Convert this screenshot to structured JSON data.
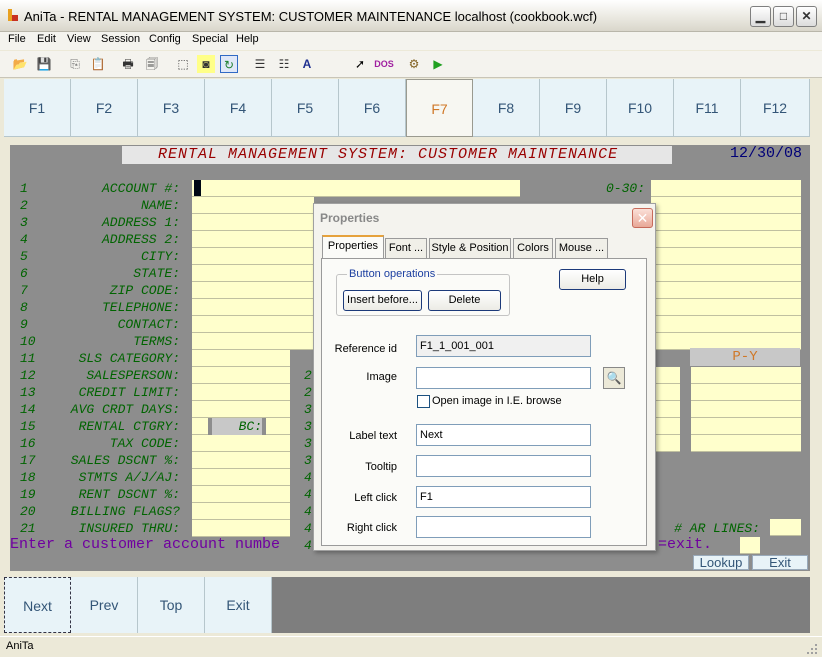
{
  "window": {
    "title": "AniTa - RENTAL MANAGEMENT SYSTEM: CUSTOMER MAINTENANCE  localhost (cookbook.wcf)",
    "minimize_glyph": "▁",
    "restore_glyph": "□",
    "close_glyph": "✕"
  },
  "menu": [
    "File",
    "Edit",
    "View",
    "Session",
    "Config",
    "Special",
    "Help"
  ],
  "toolbar_icons": [
    "open-folder-icon",
    "save-icon",
    "copy-icon",
    "paste-icon",
    "print-icon",
    "print-preview-icon",
    "select-icon",
    "toggle-icon",
    "refresh-icon",
    "list-icon",
    "list-detail-icon",
    "font-icon",
    "pointer-help-icon",
    "dos-icon",
    "settings-icon",
    "play-icon"
  ],
  "toolbar_glyphs": [
    "📂",
    "💾",
    "⎘",
    "📋",
    "🖶",
    "🗐",
    "⬚",
    "◙",
    "↻",
    "☰",
    "☷",
    "A",
    "➚",
    "DOS",
    "⚙",
    "▶"
  ],
  "fkeys": [
    "F1",
    "F2",
    "F3",
    "F4",
    "F5",
    "F6",
    "F7",
    "F8",
    "F9",
    "F10",
    "F11",
    "F12"
  ],
  "active_fkey": "F7",
  "screen": {
    "heading": "RENTAL MANAGEMENT SYSTEM: CUSTOMER MAINTENANCE",
    "date": "12/30/08",
    "rows": [
      {
        "num": "1",
        "label": "ACCOUNT #:"
      },
      {
        "num": "2",
        "label": "NAME:"
      },
      {
        "num": "3",
        "label": "ADDRESS 1:"
      },
      {
        "num": "4",
        "label": "ADDRESS 2:"
      },
      {
        "num": "5",
        "label": "CITY:"
      },
      {
        "num": "6",
        "label": "STATE:"
      },
      {
        "num": "7",
        "label": "ZIP CODE:"
      },
      {
        "num": "8",
        "label": "TELEPHONE:"
      },
      {
        "num": "9",
        "label": "CONTACT:"
      },
      {
        "num": "10",
        "label": "TERMS:"
      },
      {
        "num": "11",
        "label": "SLS CATEGORY:"
      },
      {
        "num": "12",
        "label": "SALESPERSON:"
      },
      {
        "num": "13",
        "label": "CREDIT LIMIT:"
      },
      {
        "num": "14",
        "label": "AVG CRDT DAYS:"
      },
      {
        "num": "15",
        "label": "RENTAL CTGRY:"
      },
      {
        "num": "16",
        "label": "TAX CODE:"
      },
      {
        "num": "17",
        "label": "SALES DSCNT %:"
      },
      {
        "num": "18",
        "label": "STMTS  A/J/AJ:"
      },
      {
        "num": "19",
        "label": "RENT DSCNT %:"
      },
      {
        "num": "20",
        "label": "BILLING FLAGS?"
      },
      {
        "num": "21",
        "label": "INSURED THRU:"
      }
    ],
    "mid_nums": [
      "2",
      "2",
      "3",
      "3",
      "3",
      "3",
      "4",
      "4",
      "4",
      "4",
      "4"
    ],
    "bc_label": "BC:",
    "aging_label": "0-30:",
    "py_label": "P-Y",
    "ar_lines_label": "# AR LINES:",
    "prompt_left": "Enter a customer account numbe",
    "prompt_right": "=exit.",
    "lookup_label": "Lookup",
    "exit_label": "Exit"
  },
  "bottom_buttons": [
    "Next",
    "Prev",
    "Top",
    "Exit"
  ],
  "status": "AniTa",
  "dialog": {
    "title": "Properties",
    "close_glyph": "✕",
    "tabs": [
      "Properties",
      "Font ...",
      "Style & Position",
      "Colors",
      "Mouse ..."
    ],
    "group_label": "Button operations",
    "insert_before": "Insert before...",
    "delete": "Delete",
    "help": "Help",
    "reference_id_label": "Reference id",
    "reference_id": "F1_1_001_001",
    "image_label": "Image",
    "image": "",
    "browse_glyph": "🔍",
    "open_image_label": "Open image in I.E. browse",
    "label_text_label": "Label text",
    "label_text": "Next",
    "tooltip_label": "Tooltip",
    "tooltip": "",
    "left_click_label": "Left click",
    "left_click": "F1",
    "right_click_label": "Right click",
    "right_click": ""
  },
  "colors": {
    "label_green": "#006400",
    "heading_red": "#990000",
    "field_yellow": "#ffffcc",
    "prompt_purple": "#7000a0",
    "active_fkey": "#d07828"
  }
}
